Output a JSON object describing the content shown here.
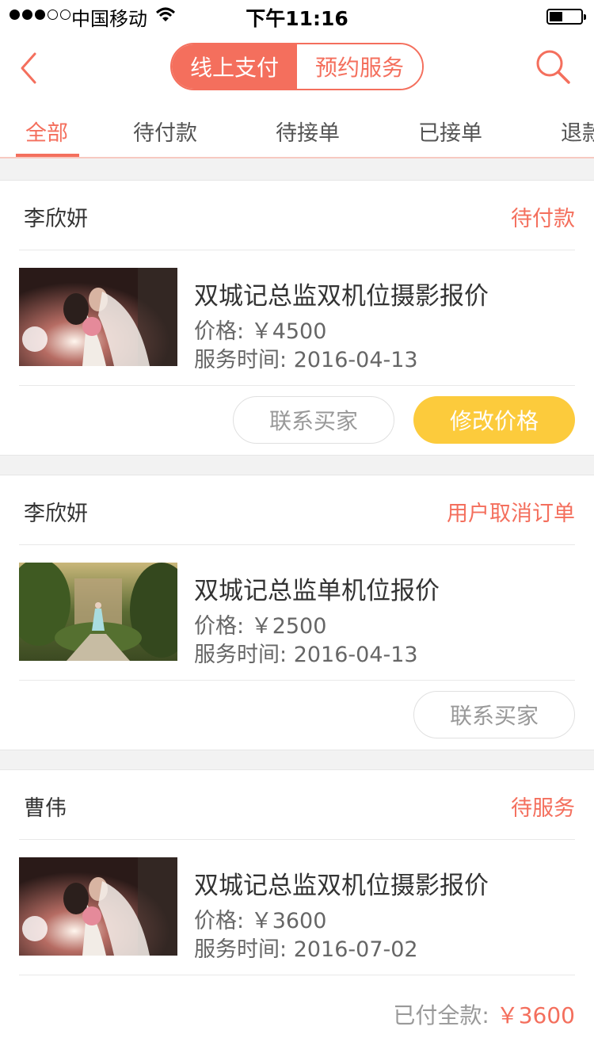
{
  "status_bar": {
    "carrier": "中国移动",
    "time": "下午11:16",
    "signal_filled": 3,
    "signal_total": 5
  },
  "nav": {
    "segments": [
      "线上支付",
      "预约服务"
    ],
    "active_segment": 0
  },
  "tabs": [
    "全部",
    "待付款",
    "待接单",
    "已接单",
    "退款"
  ],
  "active_tab": 0,
  "orders": [
    {
      "buyer": "李欣妍",
      "status": "待付款",
      "title": "双城记总监双机位摄影报价",
      "price_label": "价格:",
      "price": "￥4500",
      "time_label": "服务时间:",
      "service_time": "2016-04-13",
      "thumb": "wedding-couple-photo",
      "actions": [
        "联系买家",
        "修改价格"
      ]
    },
    {
      "buyer": "李欣妍",
      "status": "用户取消订单",
      "title": "双城记总监单机位报价",
      "price_label": "价格:",
      "price": "￥2500",
      "time_label": "服务时间:",
      "service_time": "2016-04-13",
      "thumb": "garden-wedding-photo",
      "actions": [
        "联系买家"
      ]
    },
    {
      "buyer": "曹伟",
      "status": "待服务",
      "title": "双城记总监双机位摄影报价",
      "price_label": "价格:",
      "price": "￥3600",
      "time_label": "服务时间:",
      "service_time": "2016-07-02",
      "thumb": "wedding-couple-photo",
      "paid_label": "已付全款:",
      "paid_amount": "￥3600"
    }
  ],
  "colors": {
    "accent": "#f46f5d",
    "button_yellow": "#fccb3c",
    "background": "#f2f2f2"
  }
}
